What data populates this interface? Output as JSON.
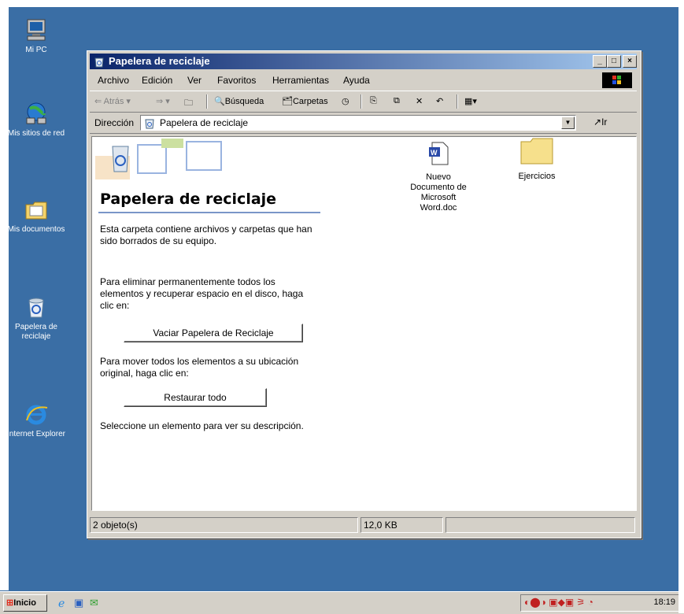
{
  "desktop": {
    "icons": [
      {
        "label": "Mi PC",
        "icon": "my-computer-icon"
      },
      {
        "label": "Mis sitios de red",
        "icon": "network-places-icon"
      },
      {
        "label": "Mis documentos",
        "icon": "my-documents-icon"
      },
      {
        "label": "Papelera de reciclaje",
        "icon": "recycle-bin-icon"
      },
      {
        "label": "Internet Explorer",
        "icon": "internet-explorer-icon"
      }
    ]
  },
  "window": {
    "title": "Papelera de reciclaje",
    "controls": {
      "minimize": "_",
      "maximize": "□",
      "close": "×"
    },
    "menu": [
      "Archivo",
      "Edición",
      "Ver",
      "Favoritos",
      "Herramientas",
      "Ayuda"
    ],
    "toolbar": {
      "back": "Atrás",
      "search": "Búsqueda",
      "folders": "Carpetas"
    },
    "address": {
      "label": "Dirección",
      "value": "Papelera de reciclaje",
      "go": "Ir"
    },
    "panel": {
      "title": "Papelera de reciclaje",
      "intro": "Esta carpeta contiene archivos y carpetas que han sido borrados de su equipo.",
      "empty_text": "Para eliminar permanentemente todos los elementos y recuperar espacio en el disco, haga clic en:",
      "empty_button": "Vaciar Papelera de Reciclaje",
      "restore_text": "Para mover todos los elementos a su ubicación original, haga clic en:",
      "restore_button": "Restaurar todo",
      "select_text": "Seleccione un elemento para ver su descripción."
    },
    "files": [
      {
        "name": "Nuevo Documento de Microsoft Word.doc",
        "icon": "word-document-icon"
      },
      {
        "name": "Ejercicios",
        "icon": "folder-icon"
      }
    ],
    "status": {
      "objects": "2 objeto(s)",
      "size": "12,0 KB"
    }
  },
  "taskbar": {
    "start": "Inicio",
    "clock": "18:19"
  },
  "colors": {
    "desktop": "#3a6ea5",
    "titlebar_start": "#0a246a",
    "titlebar_end": "#a6caf0",
    "window_face": "#d4d0c8"
  }
}
